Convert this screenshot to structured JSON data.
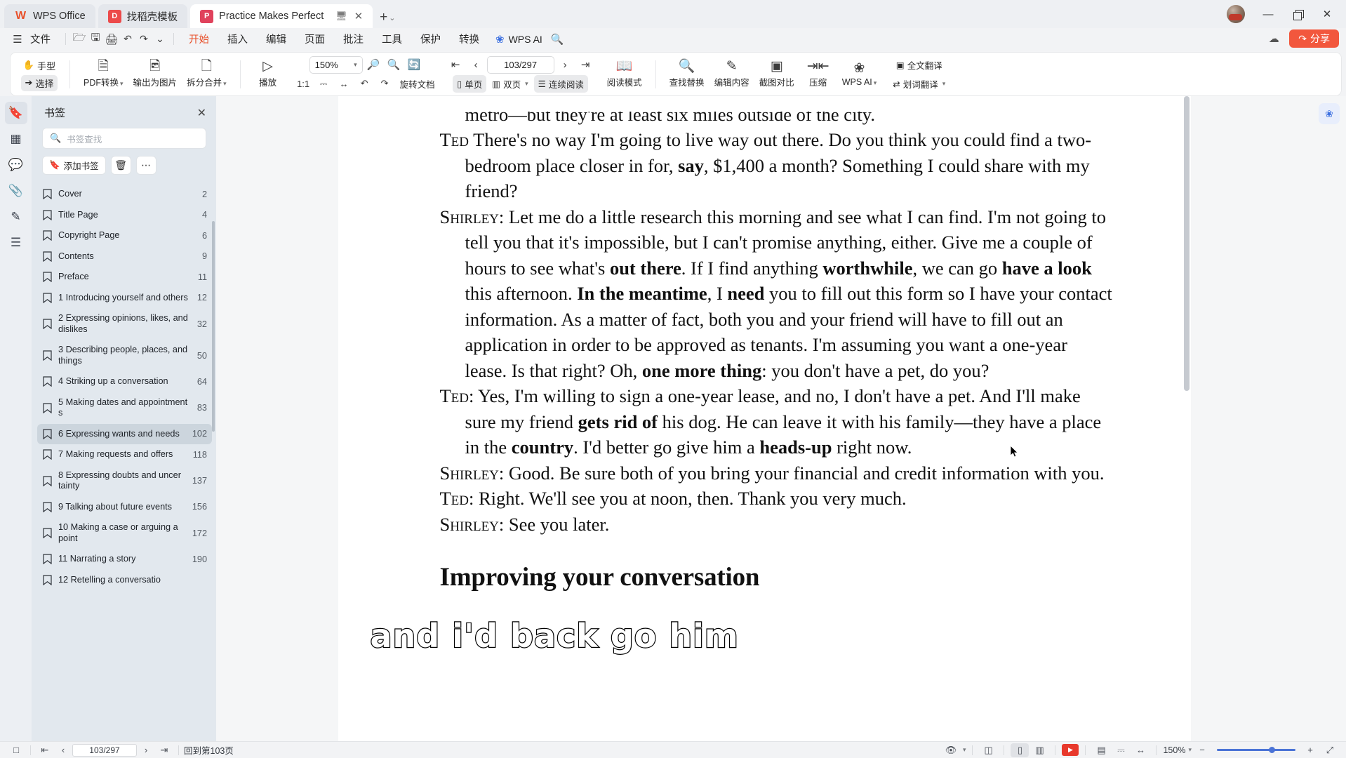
{
  "window": {
    "tabs": [
      {
        "label": "WPS Office",
        "icon": "wps-logo-icon",
        "state": "home"
      },
      {
        "label": "找稻壳模板",
        "icon": "docer-icon",
        "state": "inactive"
      },
      {
        "label": "Practice Makes Perfect Engl",
        "icon": "pdf-icon",
        "state": "active"
      }
    ],
    "new_tab": "+",
    "tab_overflow_caret": "⌄",
    "controls": {
      "minimize": "—",
      "restore": "❐",
      "close": "✕"
    }
  },
  "menubar": {
    "file_label": "文件",
    "quick_actions": [
      "open-icon",
      "save-icon",
      "print-icon",
      "undo-icon",
      "redo-icon",
      "customize-caret-icon"
    ],
    "items": [
      {
        "label": "开始",
        "active": true
      },
      {
        "label": "插入",
        "active": false
      },
      {
        "label": "编辑",
        "active": false
      },
      {
        "label": "页面",
        "active": false
      },
      {
        "label": "批注",
        "active": false
      },
      {
        "label": "工具",
        "active": false
      },
      {
        "label": "保护",
        "active": false
      },
      {
        "label": "转换",
        "active": false
      }
    ],
    "wps_ai": "WPS AI",
    "search_icon": "search-icon",
    "cloud_icon": "cloud-sync-icon",
    "share_label": "分享"
  },
  "ribbon": {
    "hand_label": "手型",
    "select_label": "选择",
    "pdf_convert": "PDF转换",
    "export_image": "输出为图片",
    "split_merge": "拆分合并",
    "play_label": "播放",
    "zoom_value": "150%",
    "zoom_out_icon": "zoom-out-icon",
    "zoom_in_icon": "zoom-in-icon",
    "fit_ratio": "1:1",
    "fit_page_icon": "fit-page-icon",
    "fit_width_icon": "fit-width-icon",
    "rotate_left_icon": "rotate-left-icon",
    "rotate_right_icon": "rotate-right-icon",
    "rotate_doc": "旋转文档",
    "single_page": "单页",
    "double_page": "双页",
    "continuous_read": "连续阅读",
    "read_mode": "阅读模式",
    "page_indicator": "103/297",
    "first_page_icon": "first-page-icon",
    "prev_page_icon": "prev-page-icon",
    "next_page_icon": "next-page-icon",
    "last_page_icon": "last-page-icon",
    "find_replace": "查找替换",
    "edit_content": "编辑内容",
    "screenshot_compare": "截图对比",
    "compress": "压缩",
    "wps_ai": "WPS AI",
    "translate_full": "全文翻译",
    "translate_word": "划词翻译"
  },
  "rail": {
    "items": [
      {
        "name": "bookmark-rail-icon",
        "active": true
      },
      {
        "name": "thumbnail-rail-icon",
        "active": false
      },
      {
        "name": "comment-rail-icon",
        "active": false
      },
      {
        "name": "attachment-rail-icon",
        "active": false
      },
      {
        "name": "signature-rail-icon",
        "active": false
      },
      {
        "name": "layers-rail-icon",
        "active": false
      }
    ]
  },
  "bookmarks": {
    "title": "书签",
    "close_icon": "close-icon",
    "search_placeholder": "书签查找",
    "add_label": "添加书签",
    "delete_icon": "trash-icon",
    "more_icon": "more-icon",
    "items": [
      {
        "label": "Cover",
        "page": "2",
        "selected": false
      },
      {
        "label": "Title Page",
        "page": "4",
        "selected": false
      },
      {
        "label": "Copyright Page",
        "page": "6",
        "selected": false
      },
      {
        "label": "Contents",
        "page": "9",
        "selected": false
      },
      {
        "label": "Preface",
        "page": "11",
        "selected": false
      },
      {
        "label": "1 Introducing yourself and others",
        "page": "12",
        "selected": false
      },
      {
        "label": "2 Expressing opinions, likes, and dislikes",
        "page": "32",
        "selected": false
      },
      {
        "label": "3 Describing people, places, and things",
        "page": "50",
        "selected": false
      },
      {
        "label": "4 Striking up a conversation",
        "page": "64",
        "selected": false
      },
      {
        "label": "5 Making dates and appointments",
        "page": "83",
        "selected": false
      },
      {
        "label": "6 Expressing wants and needs",
        "page": "102",
        "selected": true
      },
      {
        "label": "7 Making requests and offers",
        "page": "118",
        "selected": false
      },
      {
        "label": "8 Expressing doubts and uncertainty",
        "page": "137",
        "selected": false
      },
      {
        "label": "9 Talking about future events",
        "page": "156",
        "selected": false
      },
      {
        "label": "10 Making a case or arguing a point",
        "page": "172",
        "selected": false
      },
      {
        "label": "11 Narrating a story",
        "page": "190",
        "selected": false
      },
      {
        "label": "12 Retelling a conversatio",
        "page": "",
        "selected": false
      }
    ]
  },
  "document": {
    "clipped_line": "metro—but they're at least six miles outside of the city.",
    "paragraphs": [
      {
        "speaker": "Ted",
        "speaker_punct": "",
        "html": "<span class=\"sc\">Ted</span> There's no way I'm going to live way out there. Do you think you could find a two-bedroom place closer in for, <b>say</b>, $1,400 a month? Something I could share with my friend?"
      },
      {
        "speaker": "Shirley",
        "speaker_punct": ":",
        "html": "<span class=\"sc\">Shirley</span>: Let me do a little research this morning and see what I can find. I'm not going to tell you that it's impossible, but I can't promise anything, either. Give me a couple of hours to see what's <b>out there</b>. If I find anything <b>worthwhile</b>, we can go <b>have a look</b> this afternoon. <b>In the meantime</b>, I <b>need</b> you to fill out this form so I have your contact information. As a matter of fact, both you and your friend will have to fill out an application in order to be approved as tenants. I'm assuming you want a one-year lease. Is that right? Oh, <b>one more thing</b>: you don't have a pet, do you?"
      },
      {
        "speaker": "Ted",
        "speaker_punct": ":",
        "html": "<span class=\"sc\">Ted</span>: Yes, I'm willing to sign a one-year lease, and no, I don't have a pet. And I'll make sure my friend <b>gets rid of</b> his dog. He can leave it with his family—they have a place in the <b>country</b>. I'd better go give him a <b>heads-up</b> right now."
      },
      {
        "speaker": "Shirley",
        "speaker_punct": ":",
        "html": "<span class=\"sc\">Shirley</span>: Good. Be sure both of you bring your financial and credit information with you."
      },
      {
        "speaker": "Ted",
        "speaker_punct": ":",
        "html": "<span class=\"sc\">Ted</span>: Right. We'll see you at noon, then. Thank you very much."
      },
      {
        "speaker": "Shirley",
        "speaker_punct": ":",
        "html": "<span class=\"sc\">Shirley</span>: See you later."
      }
    ],
    "heading": "Improving your conversation",
    "caption_overlay": "and i'd back go him"
  },
  "statusbar": {
    "layout_icon": "page-layout-icon",
    "first_page_icon": "first-page-icon",
    "prev_page_icon": "prev-page-icon",
    "page_value": "103/297",
    "next_page_icon": "next-page-icon",
    "last_page_icon": "last-page-icon",
    "goto_label": "回到第103页",
    "eye_icon": "eye-icon",
    "view_split_icon": "split-view-icon",
    "view_single_icon": "single-page-view-icon",
    "view_double_icon": "double-page-view-icon",
    "play_icon": "play-icon",
    "note_icon": "note-view-icon",
    "fit_page_icon": "fit-page-icon",
    "fit_width_icon": "fit-width-icon",
    "zoom_value": "150%",
    "zoom_caret": "⌄",
    "zoom_minus": "−",
    "zoom_plus": "+",
    "fullscreen_icon": "fullscreen-icon"
  },
  "colors": {
    "accent": "#e8502a",
    "share": "#f2573d",
    "panel": "#e2e8ee",
    "selection": "#ccd5dd"
  }
}
